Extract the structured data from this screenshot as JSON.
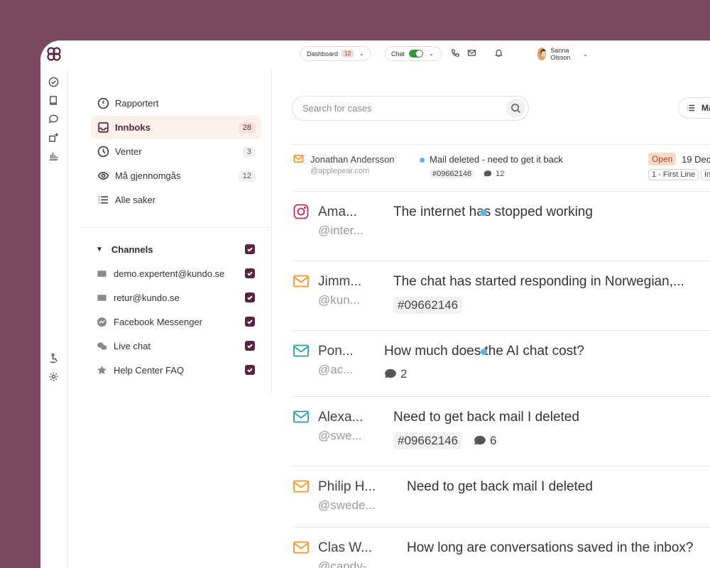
{
  "topbar": {
    "dashboard_label": "Dashboard",
    "dashboard_count": "12",
    "chat_label": "Chat",
    "user_name": "Sanna Olsson"
  },
  "rail": {
    "icons": [
      "logo-icon",
      "check-circle-icon",
      "book-icon",
      "chat-bubble-icon",
      "add-widget-icon",
      "bar-chart-icon",
      "accessibility-icon",
      "gear-icon"
    ]
  },
  "sidebar": {
    "items": [
      {
        "label": "Rapportert",
        "count": null
      },
      {
        "label": "Innboks",
        "count": "28"
      },
      {
        "label": "Venter",
        "count": "3"
      },
      {
        "label": "Må gjennomgås",
        "count": "12"
      },
      {
        "label": "Alle saker",
        "count": null
      }
    ],
    "channels_label": "Channels",
    "channels": [
      {
        "label": "demo.expertent@kundo.se",
        "icon": "mail-icon",
        "checked": true
      },
      {
        "label": "retur@kundo.se",
        "icon": "mail-icon",
        "checked": true
      },
      {
        "label": "Facebook Messenger",
        "icon": "messenger-icon",
        "checked": true
      },
      {
        "label": "Live chat",
        "icon": "live-chat-icon",
        "checked": true
      },
      {
        "label": "Help Center FAQ",
        "icon": "star-icon",
        "checked": true
      }
    ]
  },
  "main": {
    "search_placeholder": "Search for cases",
    "view_label": "Ma",
    "cases": [
      {
        "name": "Jonathan Andersson",
        "handle": "@applepear.com",
        "subject": "Mail deleted - need to get it back",
        "tag": "#09662146",
        "comments": "12",
        "status": "Open",
        "date": "19 Dec",
        "line": "1 - First Line",
        "line2": "In"
      },
      {
        "name": "Ama...",
        "handle": "@inter...",
        "subject": "The internet has stopped working"
      },
      {
        "name": "Jimm...",
        "handle": "@kun...",
        "subject": "The chat has started responding in Norwegian,...",
        "tag": "#09662146"
      },
      {
        "name": "Pon...",
        "handle": "@ac...",
        "subject": "How much does the AI chat cost?",
        "comments": "2"
      },
      {
        "name": "Alexa...",
        "handle": "@swe...",
        "subject": "Need to get back mail I deleted",
        "tag": "#09662146",
        "comments": "6"
      },
      {
        "name": "Philip H...",
        "handle": "@swede...",
        "subject": "Need to get back mail I deleted"
      },
      {
        "name": "Clas W...",
        "handle": "@candy-...",
        "subject": "How long are conversations saved in the inbox?"
      }
    ]
  },
  "colors": {
    "background": "#7a4a5f",
    "accent": "#5b2540",
    "mail_orange": "#f0962a",
    "mail_teal": "#2a9ea6",
    "instagram": "#b0306a",
    "open_badge": "#fbd9c8"
  }
}
